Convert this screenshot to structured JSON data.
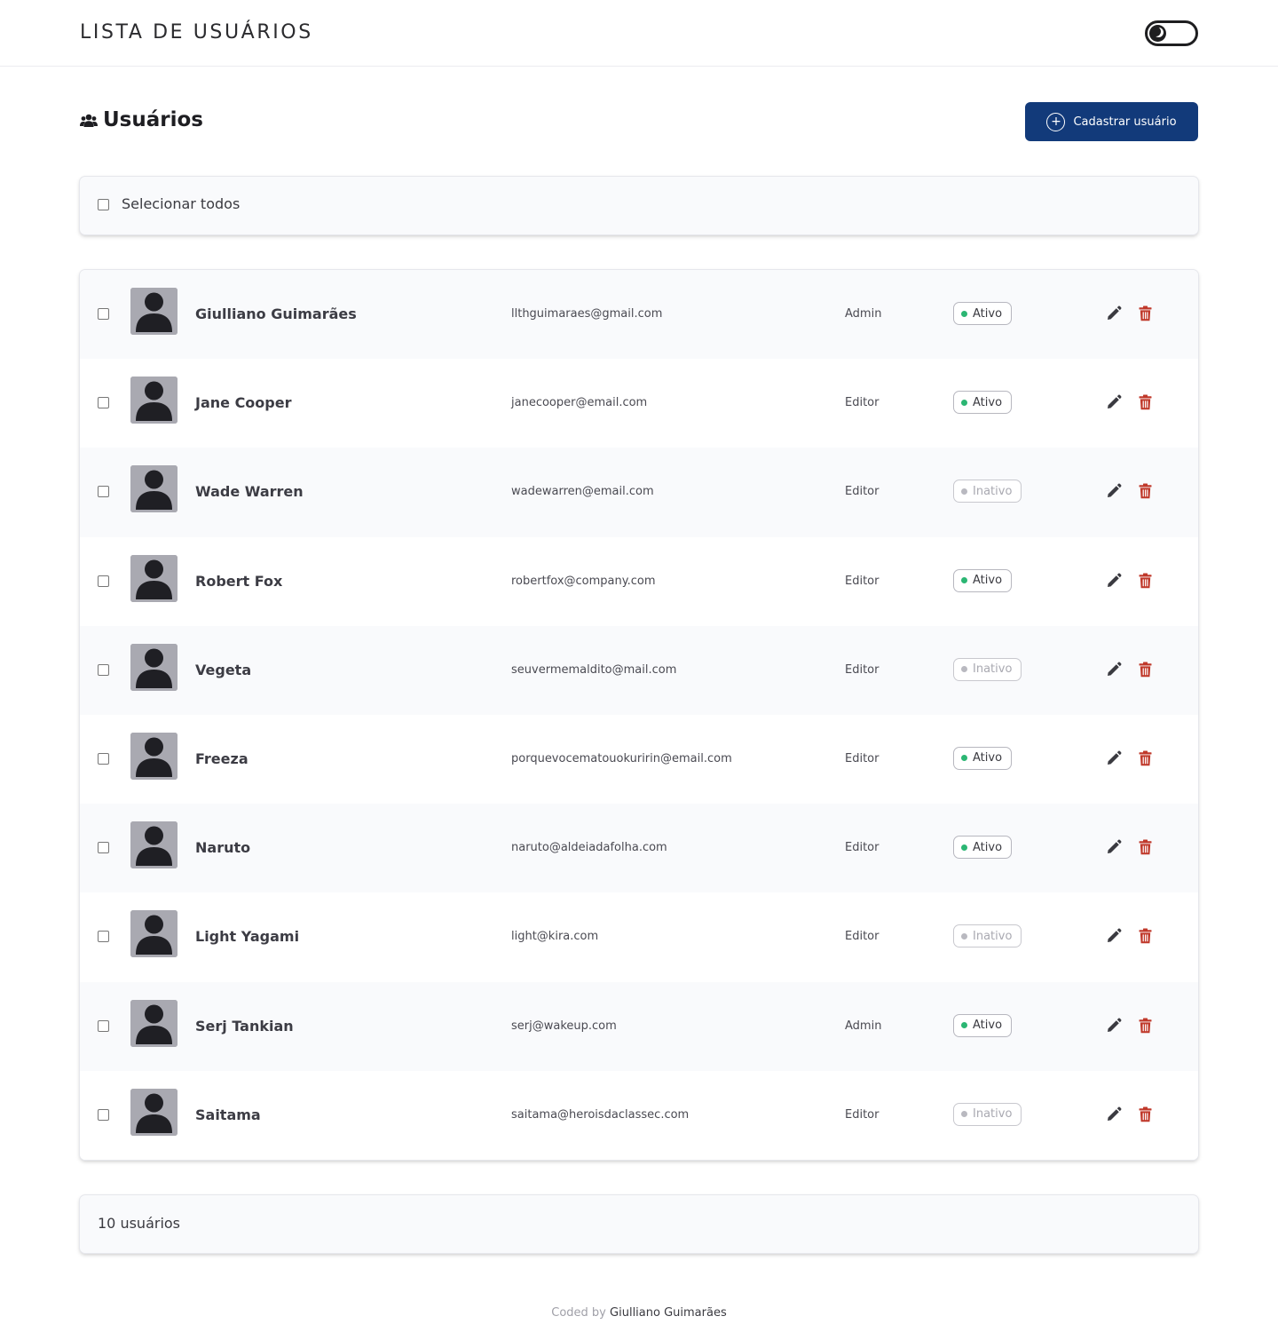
{
  "header": {
    "title": "LISTA DE USUÁRIOS",
    "theme_toggle_icon": "moon-icon"
  },
  "section": {
    "title": "Usuários",
    "add_button_label": "Cadastrar usuário"
  },
  "select_all": {
    "label": "Selecionar todos"
  },
  "users": [
    {
      "name": "Giulliano Guimarães",
      "email": "llthguimaraes@gmail.com",
      "role": "Admin",
      "status": "Ativo",
      "active": true
    },
    {
      "name": "Jane Cooper",
      "email": "janecooper@email.com",
      "role": "Editor",
      "status": "Ativo",
      "active": true
    },
    {
      "name": "Wade Warren",
      "email": "wadewarren@email.com",
      "role": "Editor",
      "status": "Inativo",
      "active": false
    },
    {
      "name": "Robert Fox",
      "email": "robertfox@company.com",
      "role": "Editor",
      "status": "Ativo",
      "active": true
    },
    {
      "name": "Vegeta",
      "email": "seuvermemaldito@mail.com",
      "role": "Editor",
      "status": "Inativo",
      "active": false
    },
    {
      "name": "Freeza",
      "email": "porquevocematouokuririn@email.com",
      "role": "Editor",
      "status": "Ativo",
      "active": true
    },
    {
      "name": "Naruto",
      "email": "naruto@aldeiadafolha.com",
      "role": "Editor",
      "status": "Ativo",
      "active": true
    },
    {
      "name": "Light Yagami",
      "email": "light@kira.com",
      "role": "Editor",
      "status": "Inativo",
      "active": false
    },
    {
      "name": "Serj Tankian",
      "email": "serj@wakeup.com",
      "role": "Admin",
      "status": "Ativo",
      "active": true
    },
    {
      "name": "Saitama",
      "email": "saitama@heroisdaclassec.com",
      "role": "Editor",
      "status": "Inativo",
      "active": false
    }
  ],
  "summary": {
    "count_label": "10 usuários"
  },
  "footer": {
    "prefix": "Coded by",
    "author": "Giulliano Guimarães"
  },
  "colors": {
    "primary": "#123a7a",
    "active_dot": "#2bb673",
    "inactive_dot": "#b9b9c0",
    "delete": "#c0392b",
    "edit": "#3a3a40"
  }
}
